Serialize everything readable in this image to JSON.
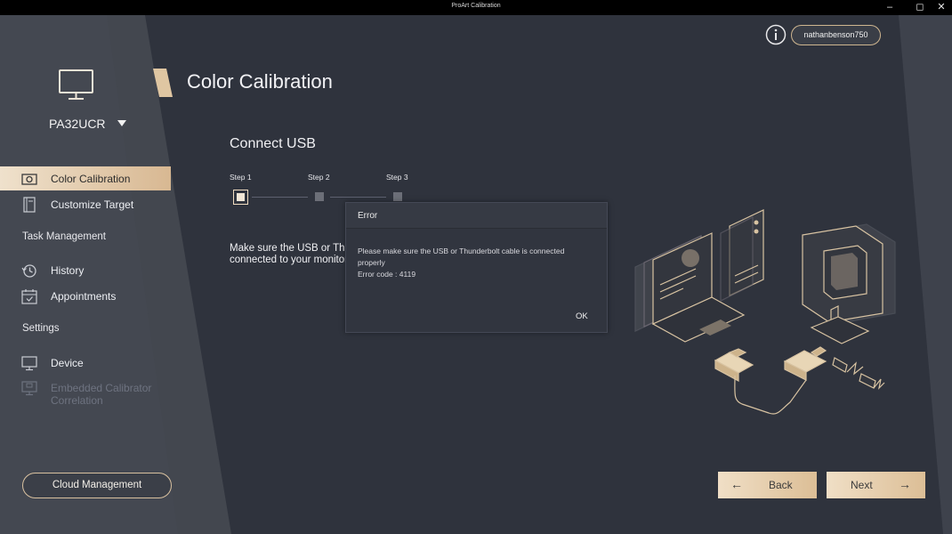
{
  "window": {
    "title": "ProArt Calibration",
    "controls": [
      "minimize",
      "maximize",
      "close"
    ]
  },
  "sidebar": {
    "device_name": "PA32UCR",
    "items": [
      {
        "label": "Color Calibration",
        "icon": "camera-icon",
        "active": true
      },
      {
        "label": "Customize Target",
        "icon": "target-book-icon",
        "active": false
      }
    ],
    "task_section": "Task Management",
    "task_items": [
      {
        "label": "History",
        "icon": "history-icon"
      },
      {
        "label": "Appointments",
        "icon": "calendar-icon"
      }
    ],
    "settings_section": "Settings",
    "settings_items": [
      {
        "label": "Device",
        "icon": "monitor-icon",
        "disabled": false
      },
      {
        "label": "Embedded Calibrator Correlation",
        "icon": "monitor-calibrator-icon",
        "disabled": true
      }
    ],
    "cloud_button": "Cloud Management"
  },
  "header": {
    "page_title": "Color Calibration",
    "username": "nathanbenson750"
  },
  "main": {
    "section_title": "Connect USB",
    "steps": [
      "Step 1",
      "Step 2",
      "Step 3"
    ],
    "current_step": 1,
    "instruction_line1": "Make sure the USB or Thunderbolt cable is",
    "instruction_line2": "connected to your monitor."
  },
  "dialog": {
    "title": "Error",
    "message_line1": "Please make sure the USB or Thunderbolt cable is connected",
    "message_line2": "properly",
    "error_code": "Error code : 4119",
    "ok_label": "OK"
  },
  "footer": {
    "back_label": "Back",
    "next_label": "Next"
  },
  "colors": {
    "accent": "#dcbe96",
    "accent_light": "#f0dfc6",
    "background": "#2f333d",
    "sidebar": "#40444e"
  }
}
